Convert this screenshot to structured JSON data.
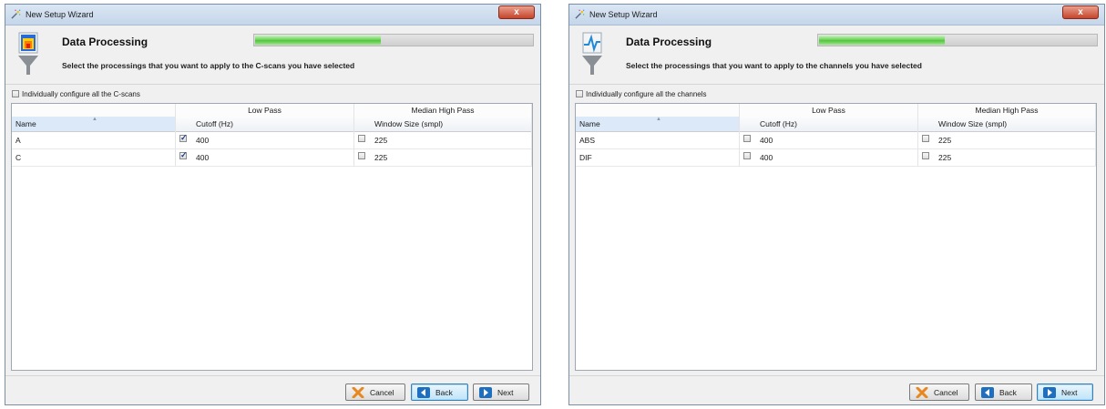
{
  "colors": {
    "accent": "#1e6fc0",
    "progress": "#52c43e",
    "close": "#c5442a"
  },
  "windows": [
    {
      "title": "New Setup Wizard",
      "close_label": "x",
      "header": {
        "title": "Data Processing",
        "subtitle": "Select the processings that you want to apply to the C-scans you have selected",
        "icon": "heatmap-funnel-icon",
        "progress": 0.45
      },
      "config_checkbox": {
        "label": "Individually configure all the C-scans",
        "checked": false
      },
      "table": {
        "groups": [
          "Low Pass",
          "Median High Pass"
        ],
        "columns": [
          "Name",
          "Cutoff (Hz)",
          "Window Size (smpl)"
        ],
        "rows": [
          {
            "name": "A",
            "lp_checked": true,
            "lp_value": "400",
            "hp_checked": false,
            "hp_value": "225"
          },
          {
            "name": "C",
            "lp_checked": true,
            "lp_value": "400",
            "hp_checked": false,
            "hp_value": "225"
          }
        ]
      },
      "buttons": {
        "cancel": "Cancel",
        "back": "Back",
        "next": "Next"
      }
    },
    {
      "title": "New Setup Wizard",
      "close_label": "x",
      "header": {
        "title": "Data Processing",
        "subtitle": "Select the processings that you want to apply to the channels you have selected",
        "icon": "waveform-funnel-icon",
        "progress": 0.45
      },
      "config_checkbox": {
        "label": "Individually configure all the channels",
        "checked": false
      },
      "table": {
        "groups": [
          "Low Pass",
          "Median High Pass"
        ],
        "columns": [
          "Name",
          "Cutoff (Hz)",
          "Window Size (smpl)"
        ],
        "rows": [
          {
            "name": "ABS",
            "lp_checked": false,
            "lp_value": "400",
            "hp_checked": false,
            "hp_value": "225"
          },
          {
            "name": "DIF",
            "lp_checked": false,
            "lp_value": "400",
            "hp_checked": false,
            "hp_value": "225"
          }
        ]
      },
      "buttons": {
        "cancel": "Cancel",
        "back": "Back",
        "next": "Next"
      }
    }
  ]
}
